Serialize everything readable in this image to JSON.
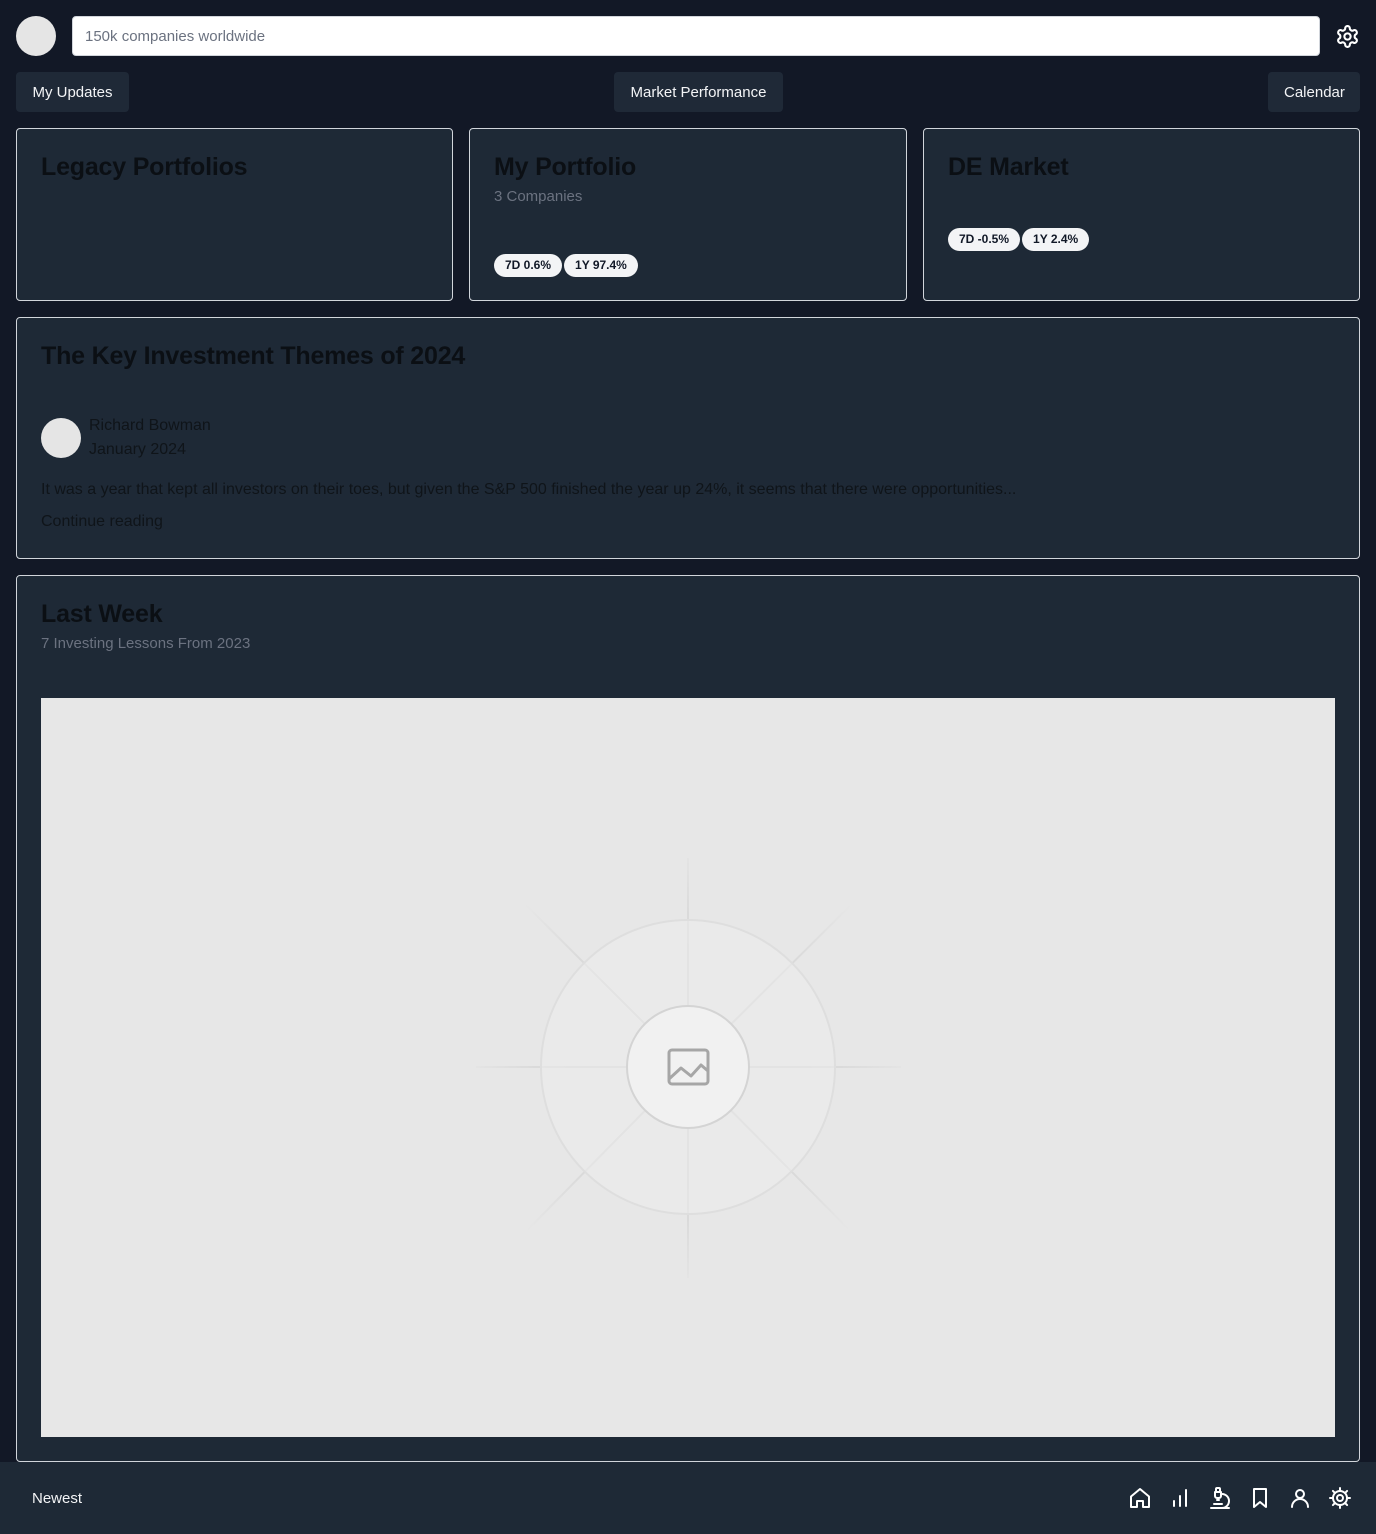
{
  "header": {
    "search_placeholder": "150k companies worldwide",
    "settings_icon": "gear-icon"
  },
  "tabs": {
    "left": "My Updates",
    "center": "Market Performance",
    "right": "Calendar"
  },
  "cards": {
    "legacy": {
      "title": "Legacy Portfolios"
    },
    "portfolio": {
      "title": "My Portfolio",
      "subtitle": "3 Companies",
      "pill_7d": "7D 0.6%",
      "pill_1y": "1Y 97.4%"
    },
    "market": {
      "title": "DE Market",
      "pill_7d": "7D -0.5%",
      "pill_1y": "1Y 2.4%"
    }
  },
  "article": {
    "title": "The Key Investment Themes of 2024",
    "author": "Richard Bowman",
    "date": "January 2024",
    "excerpt": "It was a year that kept all investors on their toes, but given the S&P 500 finished the year up 24%, it seems that there were opportunities...",
    "continue_label": "Continue reading"
  },
  "last_week": {
    "title": "Last Week",
    "subtitle": "7 Investing Lessons From 2023",
    "image_icon": "image-placeholder-icon"
  },
  "bottom_nav": {
    "sort_label": "Newest",
    "icons": [
      "home-icon",
      "bar-chart-icon",
      "microscope-icon",
      "bookmark-icon",
      "user-icon",
      "settings-icon"
    ]
  },
  "colors": {
    "page_bg": "#121826",
    "card_bg": "#1e2936",
    "card_border": "#d1d5db",
    "pill_bg": "#f3f4f6",
    "button_bg": "#1f2937"
  }
}
